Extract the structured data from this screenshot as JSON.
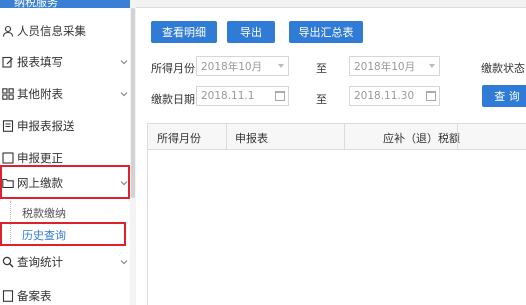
{
  "sidebar": {
    "header_text": "纳税服务",
    "items": [
      {
        "label": "人员信息采集"
      },
      {
        "label": "报表填写",
        "chevron": "down"
      },
      {
        "label": "其他附表",
        "chevron": "down"
      },
      {
        "label": "申报表报送"
      },
      {
        "label": "申报更正"
      },
      {
        "label": "网上缴款",
        "chevron": "down"
      },
      {
        "label": "查询统计",
        "chevron": "down"
      },
      {
        "label": "备案表"
      }
    ],
    "sub_items": [
      {
        "label": "税款缴纳"
      },
      {
        "label": "历史查询"
      }
    ]
  },
  "toolbar": {
    "view_detail": "查看明细",
    "export": "导出",
    "export_summary": "导出汇总表"
  },
  "form": {
    "income_month_label": "所得月份：",
    "income_month_from": "2018年10月",
    "to_label_1": "至",
    "income_month_to": "2018年10月",
    "status_label": "缴款状态：",
    "payment_date_label": "缴款日期：",
    "payment_date_from": "2018.11.1",
    "to_label_2": "至",
    "payment_date_to": "2018.11.30",
    "query_button": "查 询"
  },
  "table": {
    "columns": [
      "所得月份",
      "申报表",
      "应补（退）税额"
    ]
  },
  "colors": {
    "accent": "#2f7bd6",
    "highlight_box": "#e0202a"
  }
}
